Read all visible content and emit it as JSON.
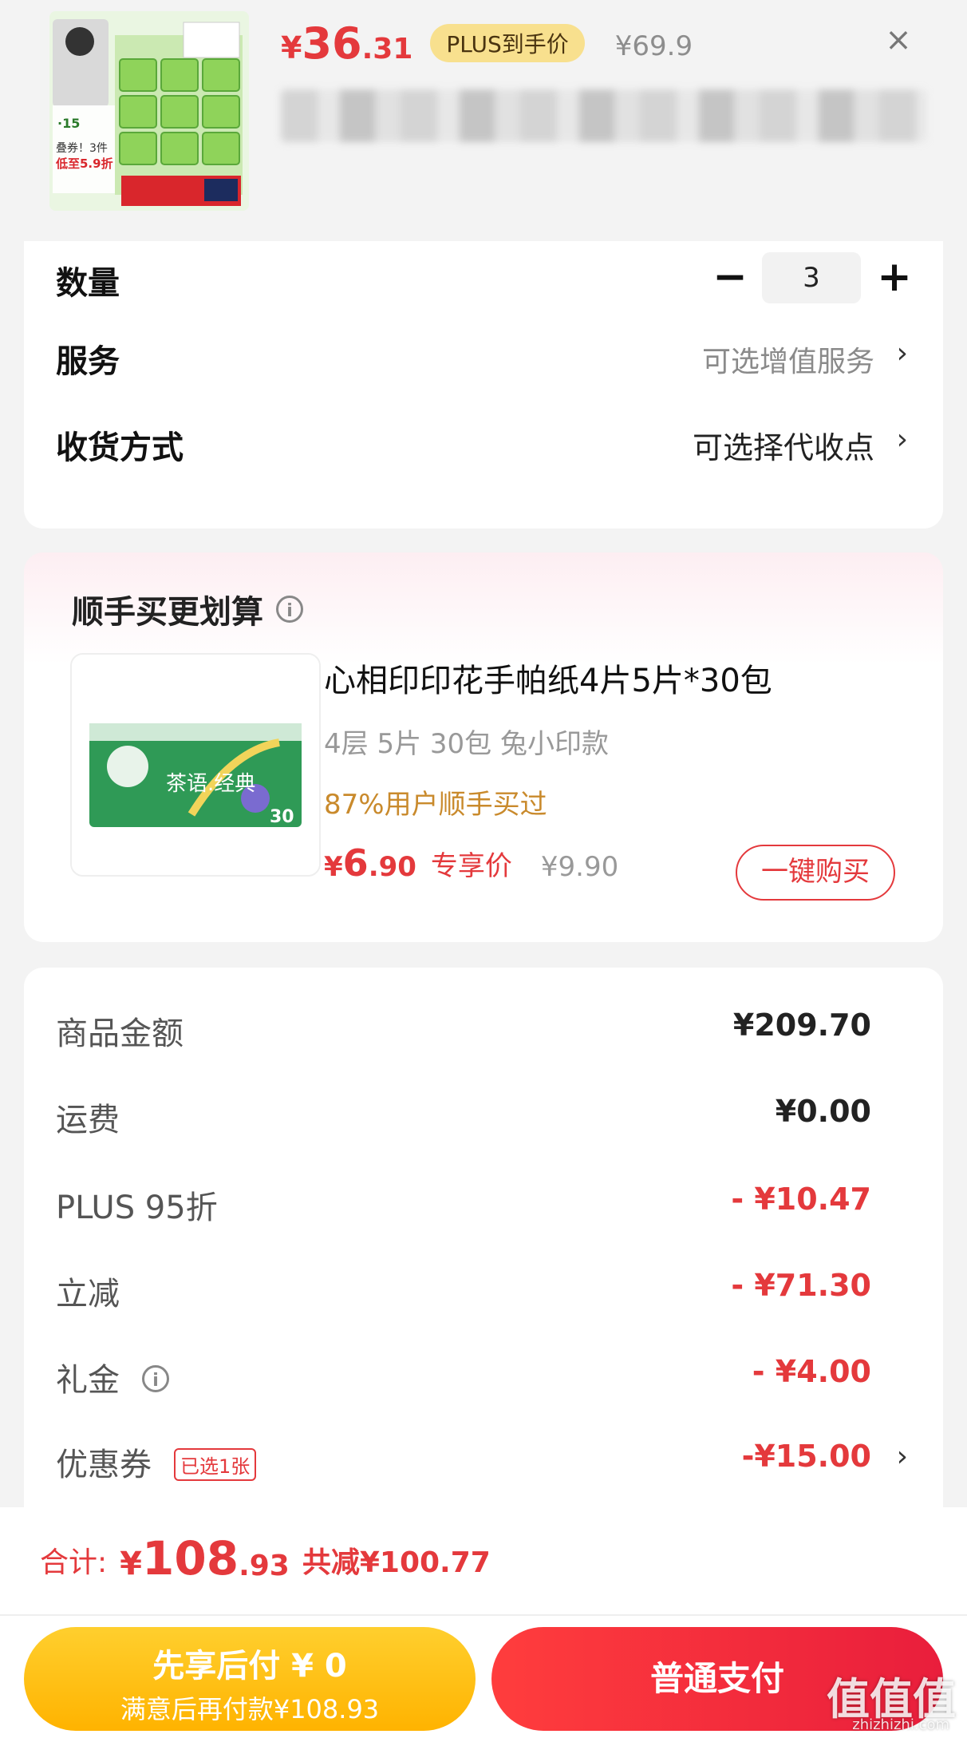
{
  "product": {
    "price_symbol": "¥",
    "price_int": "36",
    "price_dec": ".31",
    "plus_badge": "PLUS到手价",
    "original_price": "¥69.9",
    "close_icon": "×",
    "thumb_lines": [
      "低至5.9折",
      "·15",
      "叠券！3件"
    ]
  },
  "options": {
    "quantity_label": "数量",
    "quantity_value": "3",
    "minus": "−",
    "plus": "+",
    "service_label": "服务",
    "service_value": "可选增值服务",
    "delivery_label": "收货方式",
    "delivery_value": "可选择代收点",
    "chevron": "›"
  },
  "addon": {
    "title": "顺手买更划算",
    "info_icon": "i",
    "name": "心相印印花手帕纸4片5片*30包",
    "spec": "4层 5片 30包 兔小印款",
    "hint": "87%用户顺手买过",
    "price_symbol": "¥",
    "price_int": "6",
    "price_dec": ".90",
    "price_tag": "专享价",
    "original_price": "¥9.90",
    "buy_label": "一键购买",
    "image_text": "茶语.经典",
    "image_count": "30"
  },
  "summary": {
    "rows": [
      {
        "label": "商品金额",
        "value": "¥209.70"
      },
      {
        "label": "运费",
        "value": "¥0.00"
      },
      {
        "label": "PLUS 95折",
        "value": "- ¥10.47"
      },
      {
        "label": "立减",
        "value": "- ¥71.30"
      },
      {
        "label": "礼金",
        "value": "- ¥4.00"
      },
      {
        "label": "优惠券",
        "value": "-¥15.00"
      }
    ],
    "coupon_tag": "已选1张",
    "info_icon": "i",
    "chevron": "›"
  },
  "footer": {
    "total_label": "合计:",
    "total_symbol": "¥",
    "total_int": "108",
    "total_dec": ".93",
    "total_saved": "共减¥100.77",
    "pay_later_line1": "先享后付 ¥ 0",
    "pay_later_line2": "满意后再付款¥108.93",
    "pay_normal": "普通支付",
    "watermark": "值值值",
    "watermark_sub": "zhizhizhi.com"
  },
  "colors": {
    "accent_red": "#e4393c",
    "plus_gold": "#f8e08e",
    "pay_later_yellow": "#ffb300",
    "hint_orange": "#c98a2c"
  }
}
